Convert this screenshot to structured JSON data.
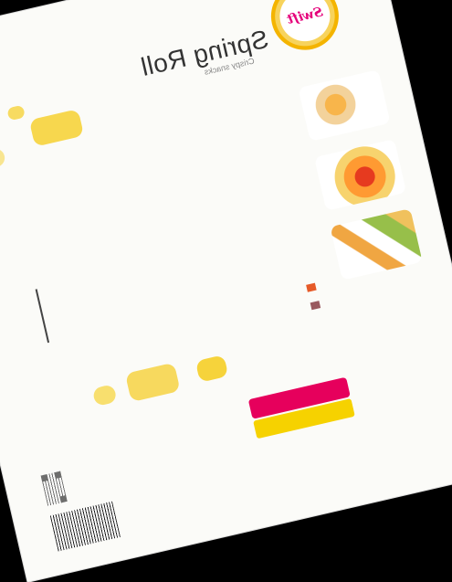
{
  "brand": "Swift",
  "product_title": "Spring Roll",
  "product_subtitle": "Crispy snacks",
  "cta_text": "",
  "cta2_text": "",
  "colors": {
    "accent": "#e6005c",
    "yellow": "#f6d200"
  }
}
